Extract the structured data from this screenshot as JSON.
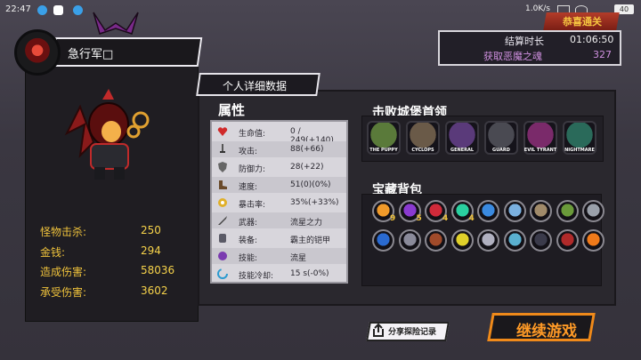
{
  "status_bar": {
    "time": "22:47",
    "network_speed": "1.0K/s",
    "battery": "40"
  },
  "player": {
    "name": "急行军□"
  },
  "left_stats": [
    {
      "label": "怪物击杀:",
      "value": "250"
    },
    {
      "label": "金钱:",
      "value": "294"
    },
    {
      "label": "造成伤害:",
      "value": "58036"
    },
    {
      "label": "承受伤害:",
      "value": "3602"
    }
  ],
  "detail_tab": {
    "label": "个人详细数据"
  },
  "attributes": {
    "title": "属性",
    "rows": [
      {
        "icon": "heart-icon",
        "label": "生命值:",
        "value": "0 / 249(+140)"
      },
      {
        "icon": "sword-icon",
        "label": "攻击:",
        "value": "88(+66)"
      },
      {
        "icon": "shield-icon",
        "label": "防御力:",
        "value": "28(+22)"
      },
      {
        "icon": "boot-icon",
        "label": "速度:",
        "value": "51(0)(0%)"
      },
      {
        "icon": "crit-icon",
        "label": "暴击率:",
        "value": "35%(+33%)"
      },
      {
        "icon": "weapon-icon",
        "label": "武器:",
        "value": "流星之力"
      },
      {
        "icon": "armor-icon",
        "label": "装备:",
        "value": "霸主的铠甲"
      },
      {
        "icon": "skill-icon",
        "label": "技能:",
        "value": "流星"
      },
      {
        "icon": "cooldown-icon",
        "label": "技能冷却:",
        "value": "15 s(-0%)"
      }
    ]
  },
  "bosses": {
    "title": "击败城堡首领",
    "items": [
      {
        "name": "THE PUPPY",
        "color": "#5a7a3a"
      },
      {
        "name": "CYCLOPS",
        "color": "#6a5a48"
      },
      {
        "name": "GENERAL",
        "color": "#5a3a7a"
      },
      {
        "name": "GUARD",
        "color": "#4a4a52"
      },
      {
        "name": "EVIL TYRANT",
        "color": "#7a2a6a"
      },
      {
        "name": "NIGHTMARE",
        "color": "#2a6a5a"
      }
    ]
  },
  "treasure": {
    "title": "宝藏背包",
    "row1": [
      {
        "color": "#f09a2a",
        "count": "9"
      },
      {
        "color": "#8a3ad0",
        "count": "5"
      },
      {
        "color": "#d02a3a",
        "count": "4"
      },
      {
        "color": "#2ad0a0",
        "count": "4"
      },
      {
        "color": "#3a8ae0",
        "count": ""
      },
      {
        "color": "#7ab0e0",
        "count": ""
      },
      {
        "color": "#a08a6a",
        "count": ""
      },
      {
        "color": "#6a9a3a",
        "count": ""
      },
      {
        "color": "#9aa0aa",
        "count": ""
      }
    ],
    "row2": [
      {
        "color": "#2a6ad0",
        "count": ""
      },
      {
        "color": "#8a8a9a",
        "count": ""
      },
      {
        "color": "#a04a2a",
        "count": ""
      },
      {
        "color": "#e0d02a",
        "count": ""
      },
      {
        "color": "#b0b0c0",
        "count": ""
      },
      {
        "color": "#5ab0d0",
        "count": ""
      },
      {
        "color": "#3a3a4a",
        "count": ""
      },
      {
        "color": "#b02a2a",
        "count": ""
      },
      {
        "color": "#f07a1a",
        "count": ""
      }
    ]
  },
  "result": {
    "banner": "恭喜通关",
    "duration_label": "结算时长",
    "duration_value": "01:06:50",
    "souls_label": "获取恶魔之魂",
    "souls_value": "327"
  },
  "buttons": {
    "share": "分享探险记录",
    "continue": "继续游戏"
  }
}
